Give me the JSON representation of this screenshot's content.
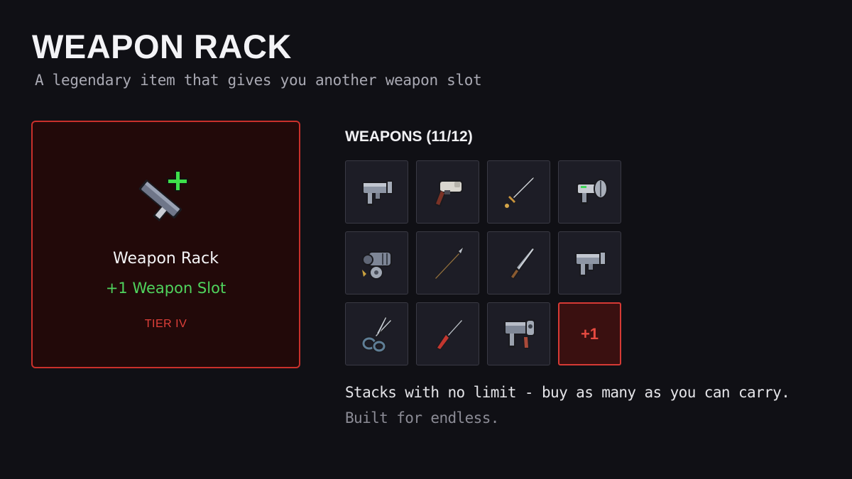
{
  "page": {
    "title": "WEAPON RACK",
    "subtitle": "A legendary item that gives you another weapon slot"
  },
  "item": {
    "name": "Weapon Rack",
    "effect": "+1 Weapon Slot",
    "tier": "TIER IV",
    "icon": "weapon-rack-icon"
  },
  "weapons": {
    "header": "WEAPONS (11/12)",
    "owned": 11,
    "capacity": 12,
    "slots": [
      {
        "icon": "smg-icon"
      },
      {
        "icon": "revolver-icon"
      },
      {
        "icon": "sword-icon"
      },
      {
        "icon": "laser-pistol-icon"
      },
      {
        "icon": "minigun-icon"
      },
      {
        "icon": "spear-icon"
      },
      {
        "icon": "knife-icon"
      },
      {
        "icon": "smg-icon"
      },
      {
        "icon": "scissors-icon"
      },
      {
        "icon": "screwdriver-icon"
      },
      {
        "icon": "heavy-pistol-icon"
      }
    ],
    "extra_slot_label": "+1"
  },
  "notes": {
    "line1": "Stacks with no limit - buy as many as you can carry.",
    "line2": "Built for endless."
  },
  "colors": {
    "background": "#101015",
    "card_border": "#c9302b",
    "card_bg": "#220909",
    "effect_green": "#4fd35d",
    "tier_red": "#e0403a",
    "extra_slot_red": "#e64a40"
  }
}
